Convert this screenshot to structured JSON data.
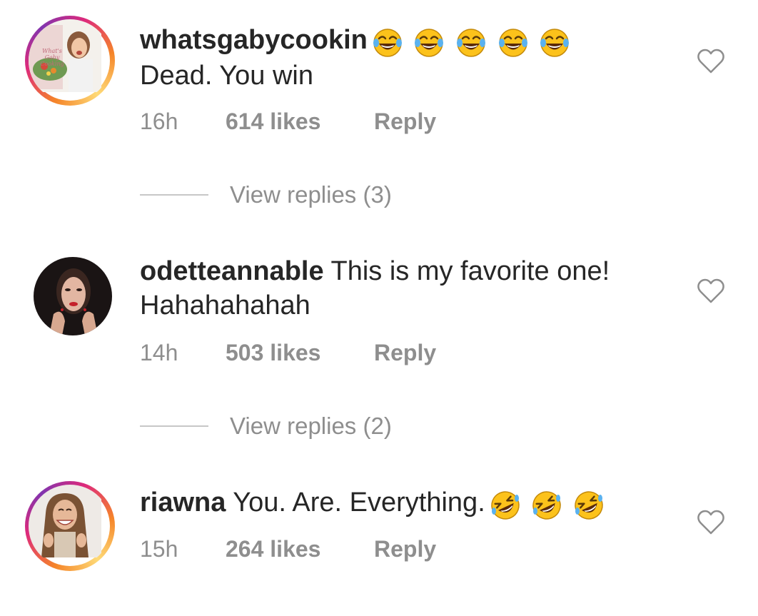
{
  "comments": [
    {
      "username": "whatsgabycookin",
      "text": "Dead. You win",
      "emoji": [
        "tears-of-joy",
        "tears-of-joy",
        "tears-of-joy",
        "tears-of-joy",
        "tears-of-joy"
      ],
      "time": "16h",
      "likes": "614 likes",
      "reply": "Reply",
      "view_replies": "View replies (3)",
      "avatar_book_text": "What's Gaby Cooking",
      "story_ring": true
    },
    {
      "username": "odetteannable",
      "text": "This is my favorite one! Hahahahahah",
      "emoji": [],
      "time": "14h",
      "likes": "503 likes",
      "reply": "Reply",
      "view_replies": "View replies (2)",
      "story_ring": false
    },
    {
      "username": "riawna",
      "text": "You. Are. Everything.",
      "emoji": [
        "rolling-laughing",
        "rolling-laughing",
        "rolling-laughing"
      ],
      "time": "15h",
      "likes": "264 likes",
      "reply": "Reply",
      "story_ring": true
    }
  ],
  "icons": {
    "like": "heart-outline-icon"
  },
  "colors": {
    "text": "#262626",
    "meta": "#8e8e8e",
    "divider": "#c7c7c7",
    "emoji_face": "#fcc21b",
    "story_ring_start": "#f58529",
    "story_ring_end": "#dd2a7b"
  }
}
